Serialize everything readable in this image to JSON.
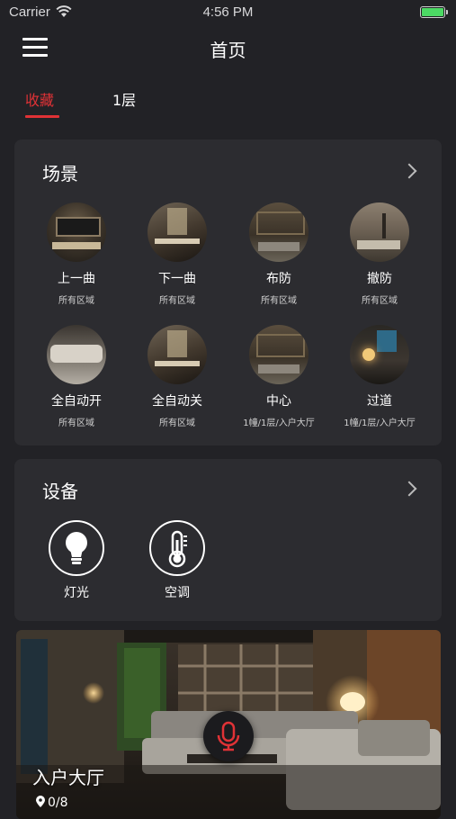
{
  "status_bar": {
    "carrier": "Carrier",
    "time": "4:56 PM",
    "battery_level": 1.0
  },
  "nav": {
    "title": "首页"
  },
  "tabs": [
    {
      "label": "收藏",
      "active": true
    },
    {
      "label": "1层",
      "active": false
    }
  ],
  "scenes": {
    "title": "场景",
    "items": [
      {
        "name": "上一曲",
        "area": "所有区域"
      },
      {
        "name": "下一曲",
        "area": "所有区域"
      },
      {
        "name": "布防",
        "area": "所有区域"
      },
      {
        "name": "撤防",
        "area": "所有区域"
      },
      {
        "name": "全自动开",
        "area": "所有区域"
      },
      {
        "name": "全自动关",
        "area": "所有区域"
      },
      {
        "name": "中心",
        "area": "1幢/1层/入户大厅"
      },
      {
        "name": "过道",
        "area": "1幢/1层/入户大厅"
      }
    ]
  },
  "devices": {
    "title": "设备",
    "items": [
      {
        "name": "灯光",
        "icon": "light-bulb-icon"
      },
      {
        "name": "空调",
        "icon": "thermometer-icon"
      }
    ]
  },
  "room": {
    "name": "入户大厅",
    "count": "0/8",
    "icon": "location-pin-icon"
  },
  "colors": {
    "accent": "#e03236",
    "background": "#222226",
    "card": "#2c2c30",
    "battery": "#4cd964"
  }
}
